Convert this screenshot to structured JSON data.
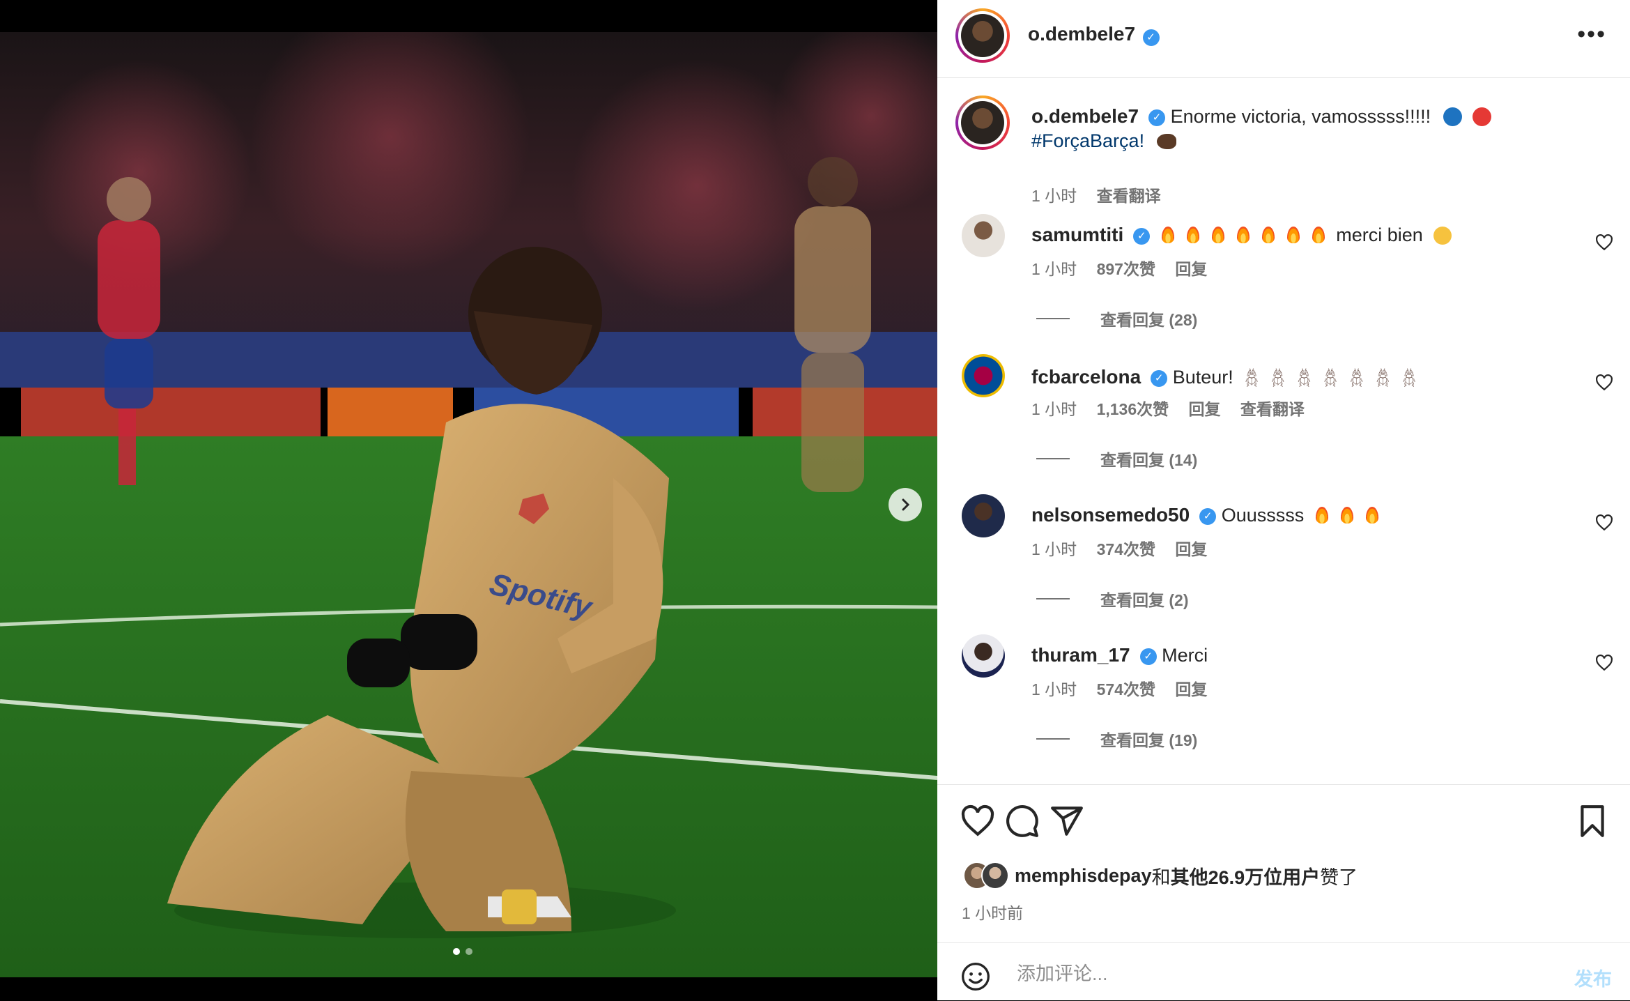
{
  "post": {
    "author": "o.dembele7",
    "media": {
      "image_alt": "Player in gold kit kneeling and celebrating on the pitch",
      "jersey_text": "Spotify",
      "slides_total": 2,
      "current_slide": 1
    },
    "caption": {
      "username": "o.dembele7",
      "text": "Enorme victoria, vamosssss!!!!!",
      "hashtag": "#ForçaBarça!",
      "time": "1 小时",
      "translate": "查看翻译"
    }
  },
  "comments": [
    {
      "username": "samumtiti",
      "text": "merci bien",
      "time": "1 小时",
      "likes": "897次赞",
      "reply": "回复",
      "view_replies": "查看回复 (28)"
    },
    {
      "username": "fcbarcelona",
      "text": "Buteur!",
      "time": "1 小时",
      "likes": "1,136次赞",
      "reply": "回复",
      "translate": "查看翻译",
      "view_replies": "查看回复 (14)"
    },
    {
      "username": "nelsonsemedo50",
      "text": "Ouusssss",
      "time": "1 小时",
      "likes": "374次赞",
      "reply": "回复",
      "view_replies": "查看回复 (2)"
    },
    {
      "username": "thuram_17",
      "text": "Merci",
      "time": "1 小时",
      "likes": "574次赞",
      "reply": "回复",
      "view_replies": "查看回复 (19)"
    }
  ],
  "likes_summary": {
    "liker": "memphisdepay",
    "connector": "和",
    "others": "其他26.9万位用户",
    "suffix": "赞了"
  },
  "posted_ago": "1 小时前",
  "composer": {
    "placeholder": "添加评论...",
    "post_label": "发布"
  },
  "colors": {
    "verified": "#3897f0",
    "post_button": "#b2dffc",
    "hashtag": "#00376b"
  },
  "icons": [
    "more-icon",
    "like-icon",
    "comment-icon",
    "share-icon",
    "save-icon",
    "emoji-icon",
    "chevron-right-icon",
    "verified-icon"
  ]
}
